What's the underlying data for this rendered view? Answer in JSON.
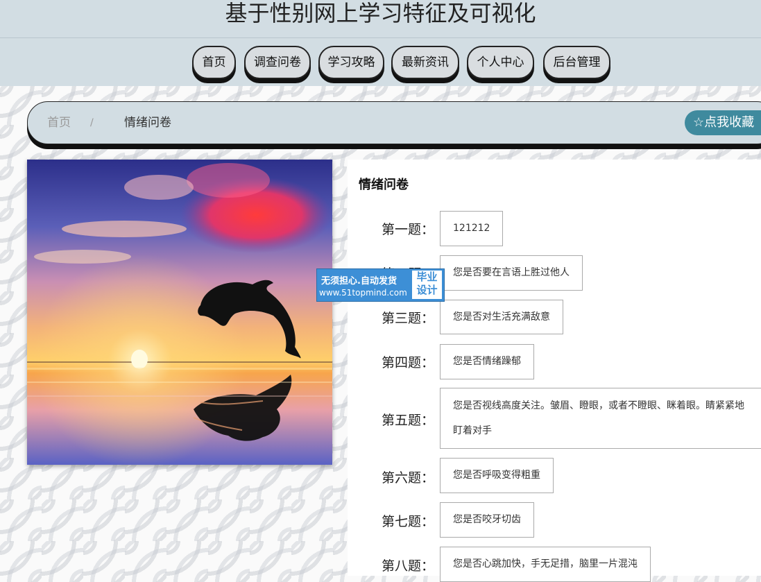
{
  "header": {
    "title": "基于性别网上学习特征及可视化"
  },
  "nav": {
    "items": [
      {
        "label": "首页"
      },
      {
        "label": "调查问卷"
      },
      {
        "label": "学习攻略"
      },
      {
        "label": "最新资讯"
      },
      {
        "label": "个人中心"
      },
      {
        "label": "后台管理"
      }
    ]
  },
  "breadcrumb": {
    "home": "首页",
    "separator": "/",
    "current": "情绪问卷",
    "favorite_label": "☆点我收藏"
  },
  "form": {
    "title": "情绪问卷",
    "questions": [
      {
        "label": "第一题：",
        "value": "121212"
      },
      {
        "label": "第二题：",
        "value": "您是否要在言语上胜过他人"
      },
      {
        "label": "第三题：",
        "value": "您是否对生活充满敌意"
      },
      {
        "label": "第四题：",
        "value": "您是否情绪躁郁"
      },
      {
        "label": "第五题：",
        "value": "您是否视线高度关注。皱眉、瞪眼，或者不瞪眼、眯着眼。睛紧紧地盯着对手"
      },
      {
        "label": "第六题：",
        "value": "您是否呼吸变得粗重"
      },
      {
        "label": "第七题：",
        "value": "您是否咬牙切齿"
      },
      {
        "label": "第八题：",
        "value": "您是否心跳加快，手无足措，脑里一片混沌"
      }
    ]
  },
  "watermark": {
    "line1": "无须担心.自动发货",
    "line2": "www.51topmind.com",
    "badge_line1": "毕业",
    "badge_line2": "设计"
  },
  "colors": {
    "header_bg": "#d2dde3",
    "accent": "#3f8a9e",
    "watermark_blue": "#3d8fd6"
  }
}
